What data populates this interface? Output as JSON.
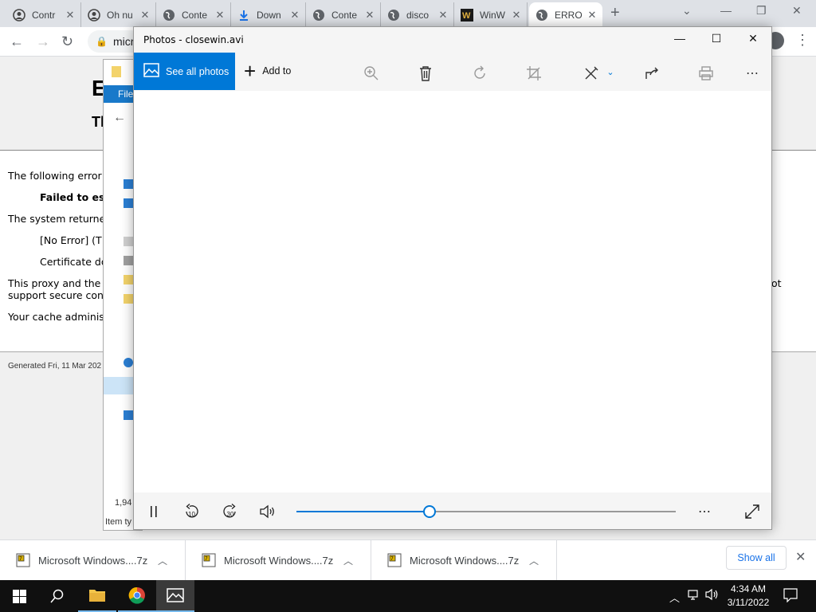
{
  "browser": {
    "tabs": [
      {
        "label": "Contr",
        "icon": "contributor-icon"
      },
      {
        "label": "Oh nu",
        "icon": "contributor-icon"
      },
      {
        "label": "Conte",
        "icon": "globe-icon"
      },
      {
        "label": "Down",
        "icon": "download-icon"
      },
      {
        "label": "Conte",
        "icon": "globe-icon"
      },
      {
        "label": "disco",
        "icon": "globe-icon"
      },
      {
        "label": "WinW",
        "icon": "winworld-icon"
      },
      {
        "label": "ERRO",
        "icon": "globe-icon"
      }
    ],
    "close_glyph": "✕",
    "new_tab_glyph": "+",
    "address_text": "micr"
  },
  "error_page": {
    "heading": "E",
    "subheading": "Tl",
    "line1": "The following error",
    "line2": "Failed to est",
    "line3": "The system returne",
    "line4": "[No Error] (T",
    "line5": "Certificate do",
    "line6a": "This proxy and the r",
    "line6b": "support secure conn",
    "line6c": "ot",
    "line7": "Your cache administ",
    "footer": "Generated Fri, 11 Mar 202"
  },
  "explorer": {
    "file_label": "File",
    "status_count": "1,94",
    "status_item": "Item ty"
  },
  "photos": {
    "title": "Photos - closewin.avi",
    "see_all_label": "See all photos",
    "add_to_label": "Add to",
    "toolbar_icons": [
      "zoom-icon",
      "delete-icon",
      "rotate-icon",
      "crop-icon",
      "edit-icon",
      "share-icon",
      "print-icon",
      "more-icon"
    ],
    "playback": {
      "skip_back_label": "10",
      "skip_forward_label": "30",
      "progress": 0.35
    },
    "accent_color": "#0078d7"
  },
  "downloads": {
    "items": [
      {
        "name": "Microsoft Windows....7z"
      },
      {
        "name": "Microsoft Windows....7z"
      },
      {
        "name": "Microsoft Windows....7z"
      }
    ],
    "show_all_label": "Show all"
  },
  "taskbar": {
    "time": "4:34 AM",
    "date": "3/11/2022"
  }
}
